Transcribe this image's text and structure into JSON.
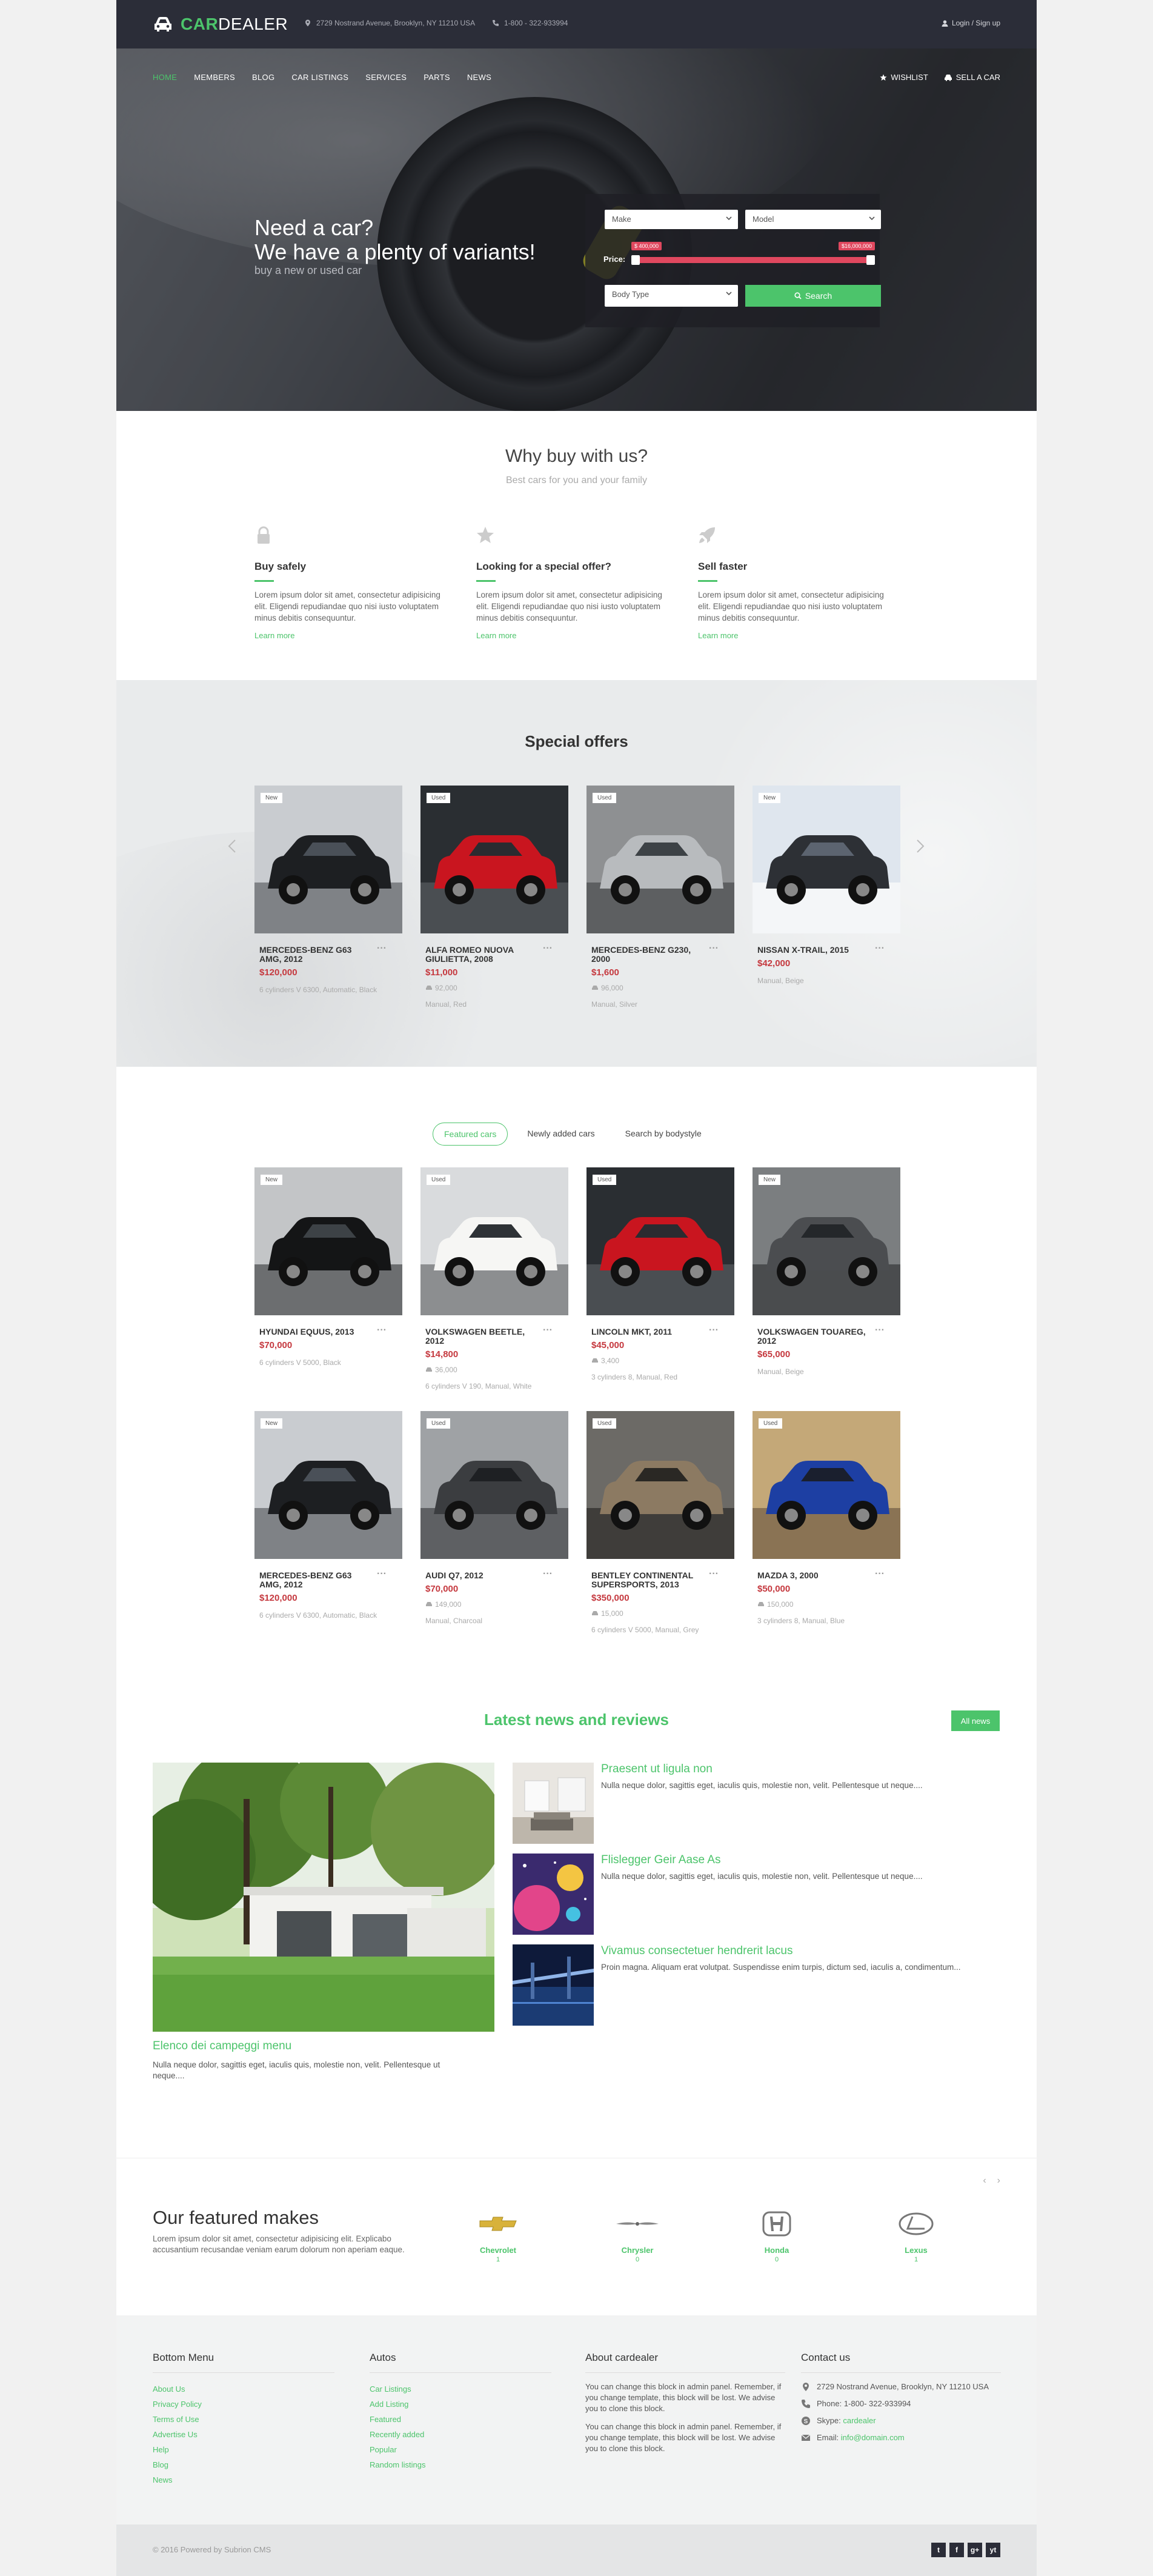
{
  "header": {
    "brand_car": "CAR",
    "brand_dealer": "DEALER",
    "address": "2729 Nostrand Avenue, Brooklyn, NY 11210 USA",
    "phone": "1-800 - 322-933994",
    "login": "Login / Sign up"
  },
  "nav": {
    "items": [
      "HOME",
      "MEMBERS",
      "BLOG",
      "CAR LISTINGS",
      "SERVICES",
      "PARTS",
      "NEWS"
    ],
    "wishlist": "WISHLIST",
    "sell": "SELL A CAR"
  },
  "hero": {
    "line1": "Need a car?",
    "line2": "We have a plenty of variants!",
    "sub": "buy a new or used car",
    "make_placeholder": "Make",
    "model_placeholder": "Model",
    "price_label": "Price:",
    "price_min": "$ 400,000",
    "price_max": "$16,000,000",
    "price_range": [
      0.0,
      1.0
    ],
    "body_type_placeholder": "Body Type",
    "search_label": "Search"
  },
  "why": {
    "title": "Why buy with us?",
    "subtitle": "Best cars for you and your family",
    "features": [
      {
        "icon": "lock-icon",
        "title": "Buy safely",
        "text": "Lorem ipsum dolor sit amet, consectetur adipisicing elit. Eligendi repudiandae quo nisi iusto voluptatem minus debitis consequuntur.",
        "more": "Learn more"
      },
      {
        "icon": "star-icon",
        "title": "Looking for a special offer?",
        "text": "Lorem ipsum dolor sit amet, consectetur adipisicing elit. Eligendi repudiandae quo nisi iusto voluptatem minus debitis consequuntur.",
        "more": "Learn more"
      },
      {
        "icon": "rocket-icon",
        "title": "Sell faster",
        "text": "Lorem ipsum dolor sit amet, consectetur adipisicing elit. Eligendi repudiandae quo nisi iusto voluptatem minus debitis consequuntur.",
        "more": "Learn more"
      }
    ]
  },
  "special": {
    "title": "Special offers",
    "cars": [
      {
        "badge": "New",
        "name": "MERCEDES-BENZ G63 AMG, 2012",
        "price": "$120,000",
        "km": "",
        "spec": "6 cylinders V 6300, Automatic, Black",
        "tone": "dark"
      },
      {
        "badge": "Used",
        "name": "ALFA ROMEO NUOVA GIULIETTA, 2008",
        "price": "$11,000",
        "km": "92,000",
        "spec": "Manual, Red",
        "tone": "red"
      },
      {
        "badge": "Used",
        "name": "MERCEDES-BENZ G230, 2000",
        "price": "$1,600",
        "km": "96,000",
        "spec": "Manual, Silver",
        "tone": "silver"
      },
      {
        "badge": "New",
        "name": "NISSAN X-TRAIL, 2015",
        "price": "$42,000",
        "km": "",
        "spec": "Manual, Beige",
        "tone": "snow"
      }
    ]
  },
  "featured": {
    "tabs": [
      "Featured cars",
      "Newly added cars",
      "Search by bodystyle"
    ],
    "cars": [
      {
        "badge": "New",
        "name": "HYUNDAI EQUUS, 2013",
        "price": "$70,000",
        "km": "",
        "spec": "6 cylinders V 5000, Black",
        "tone": "black"
      },
      {
        "badge": "Used",
        "name": "VOLKSWAGEN BEETLE, 2012",
        "price": "$14,800",
        "km": "36,000",
        "spec": "6 cylinders V 190, Manual, White",
        "tone": "white"
      },
      {
        "badge": "Used",
        "name": "LINCOLN MKT, 2011",
        "price": "$45,000",
        "km": "3,400",
        "spec": "3 cylinders 8, Manual, Red",
        "tone": "red"
      },
      {
        "badge": "New",
        "name": "VOLKSWAGEN TOUAREG, 2012",
        "price": "$65,000",
        "km": "",
        "spec": "Manual, Beige",
        "tone": "grey"
      },
      {
        "badge": "New",
        "name": "MERCEDES-BENZ G63 AMG, 2012",
        "price": "$120,000",
        "km": "",
        "spec": "6 cylinders V 6300, Automatic, Black",
        "tone": "dark"
      },
      {
        "badge": "Used",
        "name": "AUDI Q7, 2012",
        "price": "$70,000",
        "km": "149,000",
        "spec": "Manual, Charcoal",
        "tone": "charcoal"
      },
      {
        "badge": "Used",
        "name": "BENTLEY CONTINENTAL SUPERSPORTS, 2013",
        "price": "$350,000",
        "km": "15,000",
        "spec": "6 cylinders V 5000, Manual, Grey",
        "tone": "bronze"
      },
      {
        "badge": "Used",
        "name": "MAZDA 3, 2000",
        "price": "$50,000",
        "km": "150,000",
        "spec": "3 cylinders 8, Manual, Blue",
        "tone": "blue"
      }
    ]
  },
  "news": {
    "title": "Latest news and reviews",
    "all": "All news",
    "main_title": "Elenco dei campeggi menu",
    "main_text": "Nulla neque dolor, sagittis eget, iaculis quis, molestie non, velit. Pellentesque ut neque....",
    "items": [
      {
        "title": "Praesent ut ligula non",
        "text": "Nulla neque dolor, sagittis eget, iaculis quis, molestie non, velit. Pellentesque ut neque...."
      },
      {
        "title": "Flislegger Geir Aase As",
        "text": "Nulla neque dolor, sagittis eget, iaculis quis, molestie non, velit. Pellentesque ut neque...."
      },
      {
        "title": "Vivamus consectetuer hendrerit lacus",
        "text": "Proin magna. Aliquam erat volutpat. Suspendisse enim turpis, dictum sed, iaculis a, condimentum..."
      }
    ]
  },
  "makes": {
    "title": "Our featured makes",
    "text": "Lorem ipsum dolor sit amet, consectetur adipisicing elit. Explicabo accusantium recusandae veniam earum dolorum non aperiam eaque.",
    "items": [
      {
        "name": "Chevrolet",
        "count": "1"
      },
      {
        "name": "Chrysler",
        "count": "0"
      },
      {
        "name": "Honda",
        "count": "0"
      },
      {
        "name": "Lexus",
        "count": "1"
      }
    ]
  },
  "footer": {
    "menu_title": "Bottom Menu",
    "menu": [
      "About Us",
      "Privacy Policy",
      "Terms of Use",
      "Advertise Us",
      "Help",
      "Blog",
      "News"
    ],
    "autos_title": "Autos",
    "autos": [
      "Car Listings",
      "Add Listing",
      "Featured",
      "Recently added",
      "Popular",
      "Random listings"
    ],
    "about_title": "About cardealer",
    "about_p1": "You can change this block in admin panel. Remember, if you change template, this block will be lost. We advise you to clone this block.",
    "about_p2": "You can change this block in admin panel. Remember, if you change template, this block will be lost. We advise you to clone this block.",
    "contact_title": "Contact us",
    "contact_address": "2729 Nostrand Avenue, Brooklyn, NY 11210 USA",
    "contact_phone": "Phone: 1-800- 322-933994",
    "contact_skype_label": "Skype: ",
    "contact_skype": "cardealer",
    "contact_email_label": "Email: ",
    "contact_email": "info@domain.com",
    "copyright": "© 2016 Powered by Subrion CMS",
    "social": [
      "t",
      "f",
      "g+",
      "yt"
    ]
  },
  "colors": {
    "accent": "#4cc46b",
    "price": "#c5393f",
    "topbar": "#2b2d38",
    "range": "#e0485f"
  }
}
